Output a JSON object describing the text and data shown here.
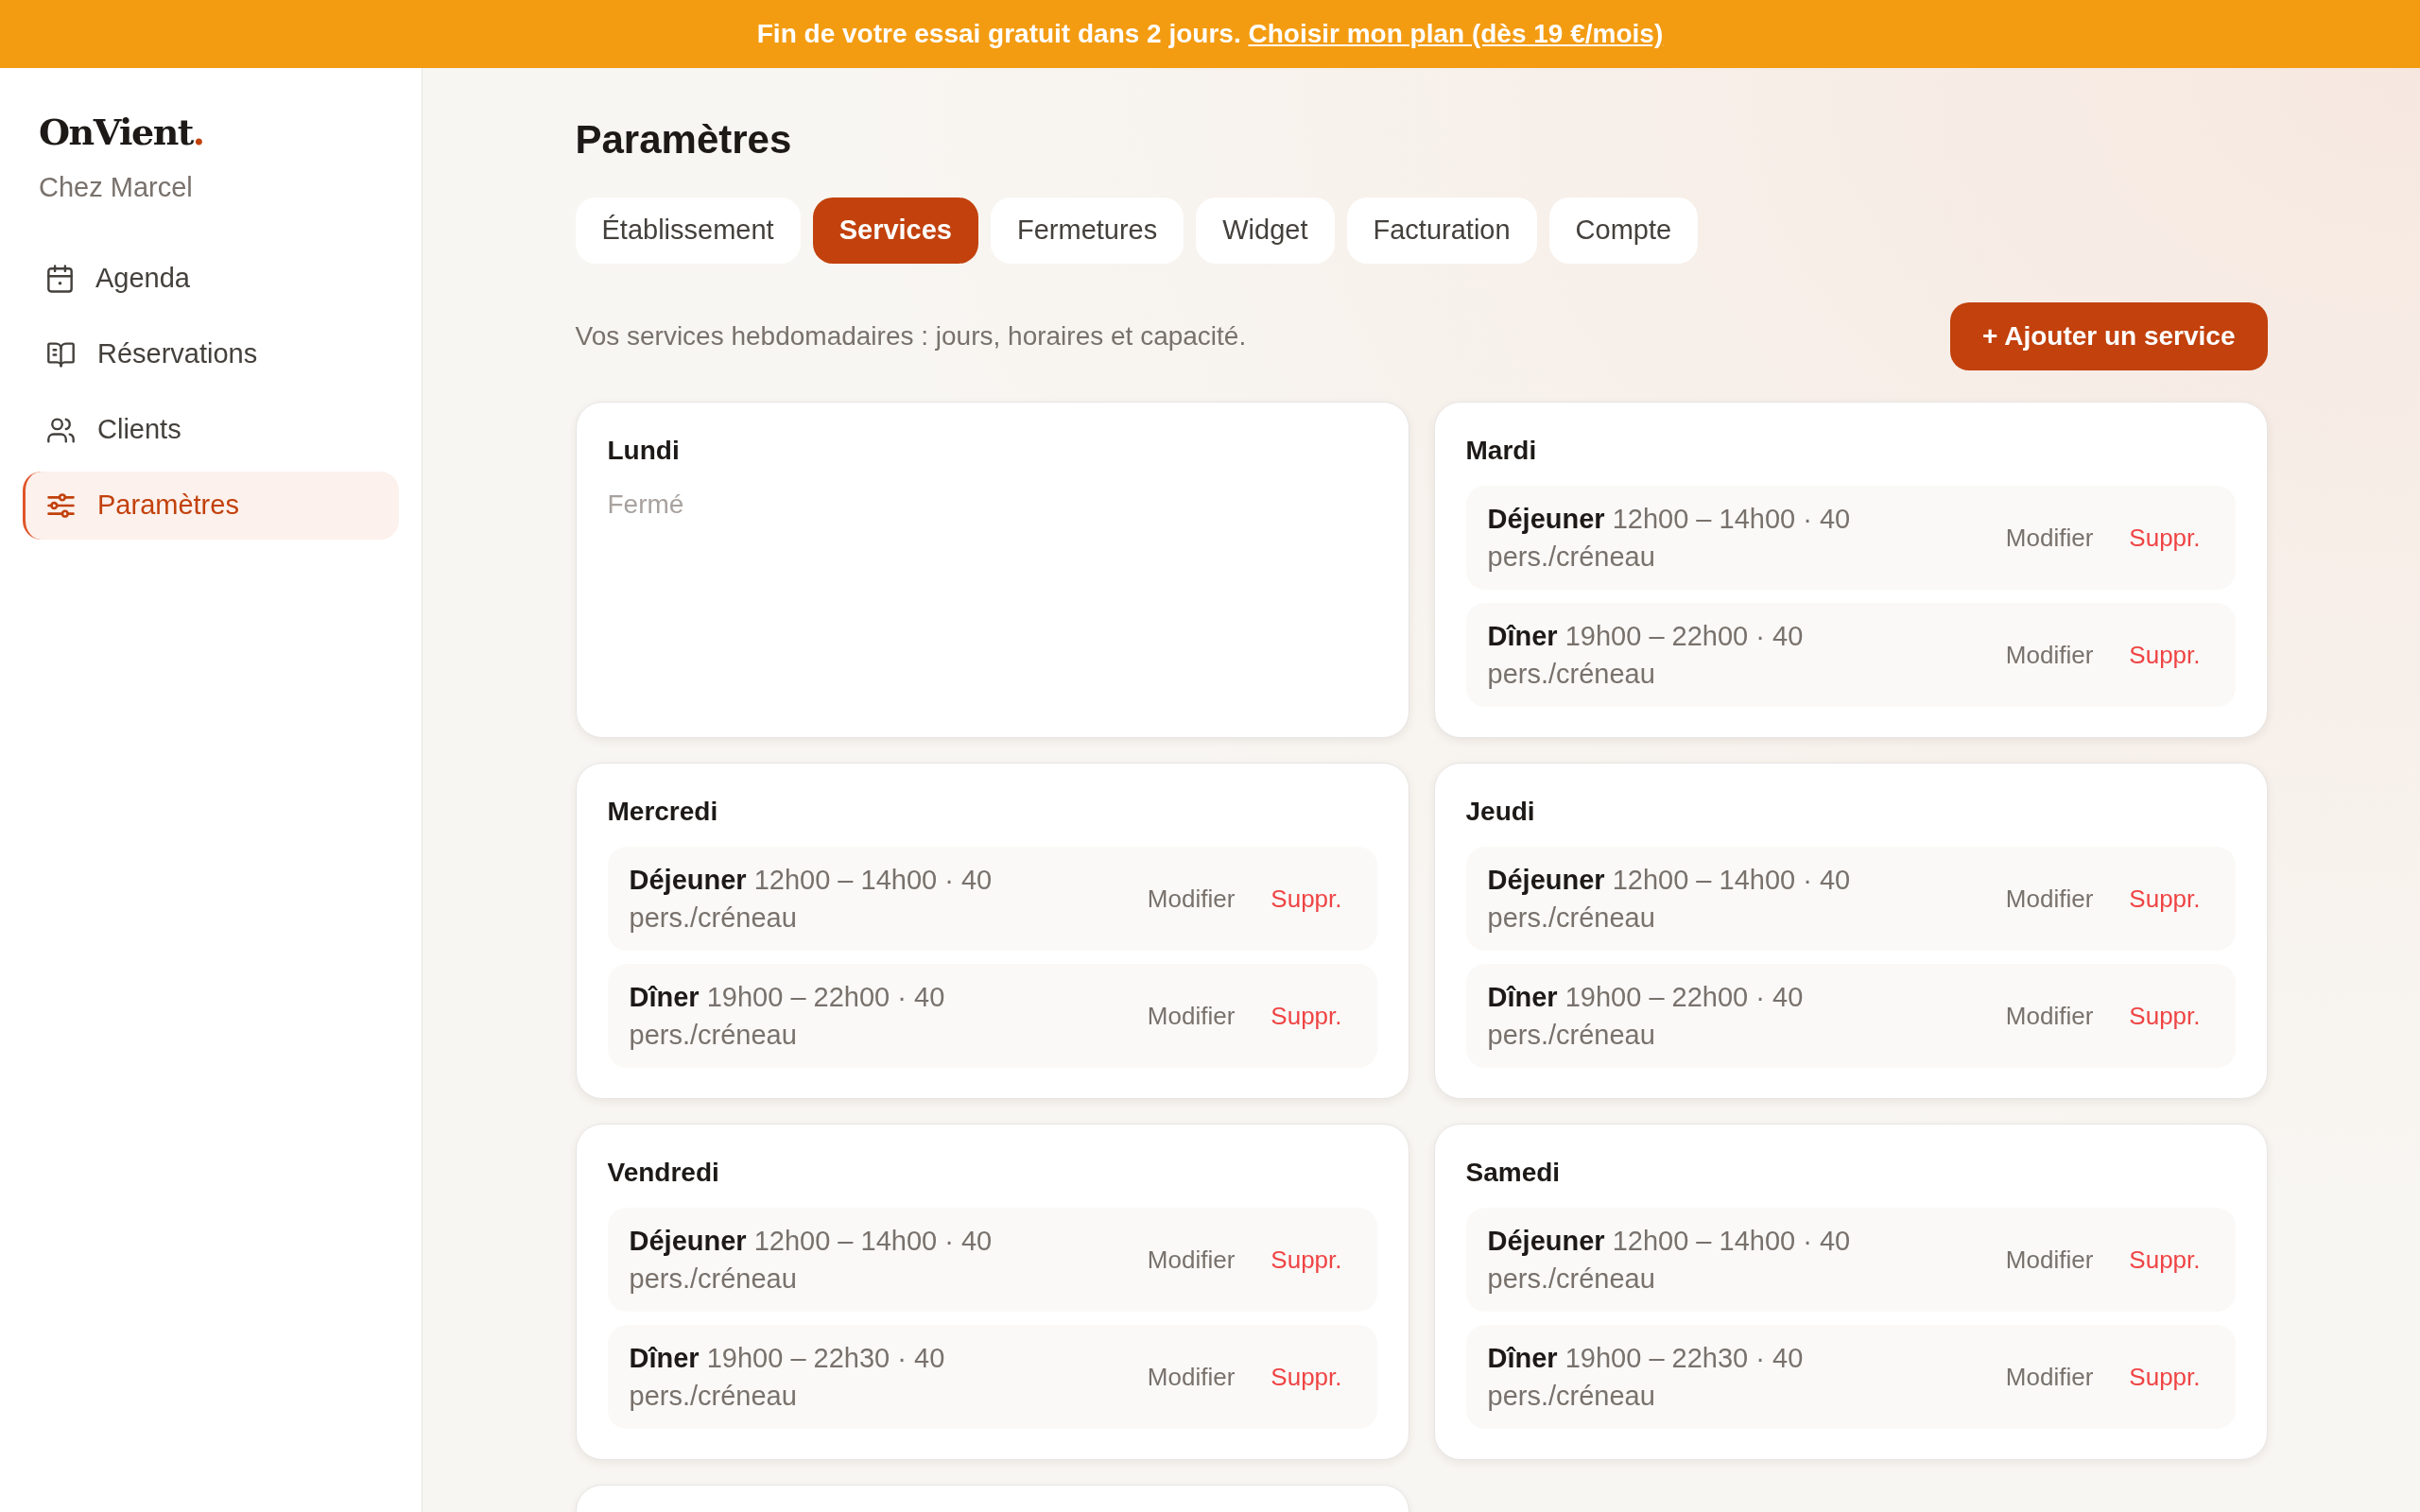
{
  "banner": {
    "text": "Fin de votre essai gratuit dans 2 jours.",
    "link": "Choisir mon plan (dès 19 €/mois)"
  },
  "sidebar": {
    "logo": {
      "text": "OnVient",
      "accent": "."
    },
    "restaurant": "Chez Marcel",
    "items": [
      {
        "label": "Agenda",
        "selected": false
      },
      {
        "label": "Réservations",
        "selected": false
      },
      {
        "label": "Clients",
        "selected": false
      },
      {
        "label": "Paramètres",
        "selected": true
      }
    ]
  },
  "page": {
    "title": "Paramètres",
    "tabs": [
      {
        "label": "Établissement",
        "selected": false
      },
      {
        "label": "Services",
        "selected": true
      },
      {
        "label": "Fermetures",
        "selected": false
      },
      {
        "label": "Widget",
        "selected": false
      },
      {
        "label": "Facturation",
        "selected": false
      },
      {
        "label": "Compte",
        "selected": false
      }
    ],
    "description": "Vos services hebdomadaires : jours, horaires et capacité.",
    "add_button": "+ Ajouter un service"
  },
  "days": [
    {
      "kind": "closed",
      "name": "Lundi",
      "closed_label": "Fermé"
    },
    {
      "kind": "open",
      "name": "Mardi",
      "services": [
        {
          "name": "Déjeuner",
          "details": "12h00 – 14h00 · 40 pers./créneau",
          "edit": "Modifier",
          "delete": "Suppr."
        },
        {
          "name": "Dîner",
          "details": "19h00 – 22h00 · 40 pers./créneau",
          "edit": "Modifier",
          "delete": "Suppr."
        }
      ]
    },
    {
      "kind": "open",
      "name": "Mercredi",
      "services": [
        {
          "name": "Déjeuner",
          "details": "12h00 – 14h00 · 40 pers./créneau",
          "edit": "Modifier",
          "delete": "Suppr."
        },
        {
          "name": "Dîner",
          "details": "19h00 – 22h00 · 40 pers./créneau",
          "edit": "Modifier",
          "delete": "Suppr."
        }
      ]
    },
    {
      "kind": "open",
      "name": "Jeudi",
      "services": [
        {
          "name": "Déjeuner",
          "details": "12h00 – 14h00 · 40 pers./créneau",
          "edit": "Modifier",
          "delete": "Suppr."
        },
        {
          "name": "Dîner",
          "details": "19h00 – 22h00 · 40 pers./créneau",
          "edit": "Modifier",
          "delete": "Suppr."
        }
      ]
    },
    {
      "kind": "open",
      "name": "Vendredi",
      "services": [
        {
          "name": "Déjeuner",
          "details": "12h00 – 14h00 · 40 pers./créneau",
          "edit": "Modifier",
          "delete": "Suppr."
        },
        {
          "name": "Dîner",
          "details": "19h00 – 22h30 · 40 pers./créneau",
          "edit": "Modifier",
          "delete": "Suppr."
        }
      ]
    },
    {
      "kind": "open",
      "name": "Samedi",
      "services": [
        {
          "name": "Déjeuner",
          "details": "12h00 – 14h00 · 40 pers./créneau",
          "edit": "Modifier",
          "delete": "Suppr."
        },
        {
          "name": "Dîner",
          "details": "19h00 – 22h30 · 40 pers./créneau",
          "edit": "Modifier",
          "delete": "Suppr."
        }
      ]
    },
    {
      "kind": "cut_off"
    }
  ]
}
